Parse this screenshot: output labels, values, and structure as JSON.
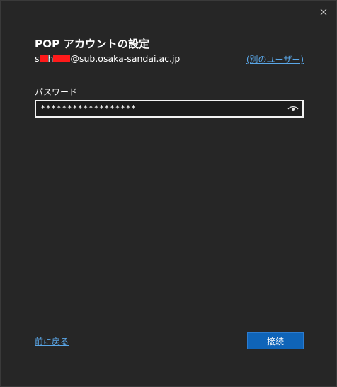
{
  "window": {
    "close_icon": "close-icon"
  },
  "header": {
    "title": "POP アカウントの設定"
  },
  "account": {
    "email_prefix_1": "s",
    "email_prefix_2": "h",
    "email_domain": "@sub.osaka-sandai.ac.jp",
    "other_user_link": "(別のユーザー)"
  },
  "password": {
    "label": "パスワード",
    "masked_value": "******************",
    "reveal_icon": "eye-icon"
  },
  "footer": {
    "back_link": "前に戻る",
    "connect_button": "接続"
  },
  "colors": {
    "background": "#262626",
    "accent": "#0f64b8",
    "link": "#5aa7e8",
    "redaction": "#ff1a1a"
  }
}
